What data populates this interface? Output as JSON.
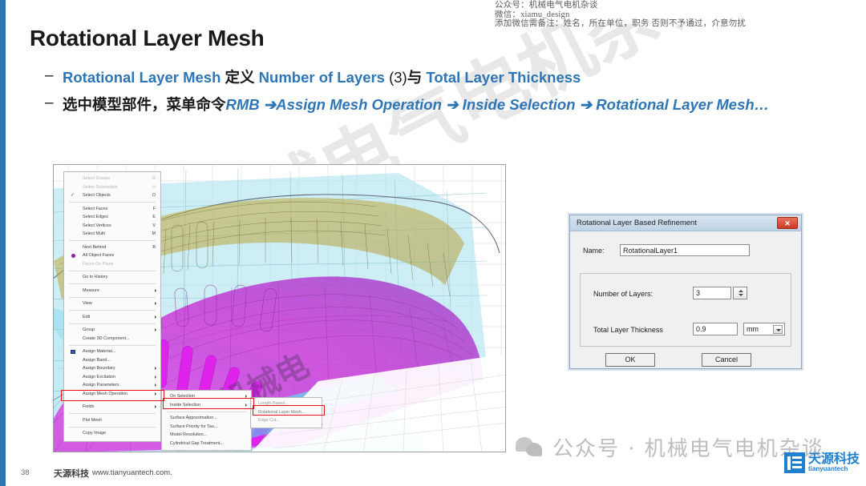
{
  "slide": {
    "title": "Rotational Layer Mesh",
    "page_number": "38",
    "accent_color": "#2e75b6"
  },
  "watermark": {
    "top_lines": [
      "公众号：机械电气电机杂谈",
      "微信：xiamu_design",
      "添加微信需备注：姓名，所在单位，职务 否则不予通过，介意勿扰"
    ],
    "diagonal_text": "机械电气电机杂谈",
    "bottom_text": "公众号 · 机械电气电机杂谈",
    "wechat_icon": "wechat-icon"
  },
  "bullets": [
    {
      "dash": "–",
      "segments": [
        {
          "text": "Rotational Layer Mesh ",
          "style": "blue"
        },
        {
          "text": "定义",
          "style": "black-cjk"
        },
        {
          "text": "  Number of Layers ",
          "style": "blue"
        },
        {
          "text": "(3)",
          "style": "black-plain"
        },
        {
          "text": "与",
          "style": "black-cjk"
        },
        {
          "text": "  Total Layer Thickness",
          "style": "blue"
        }
      ]
    },
    {
      "dash": "–",
      "segments": [
        {
          "text": "选中模型部件，菜单命令",
          "style": "black-cjk"
        },
        {
          "text": "RMB ➔Assign Mesh Operation ➔ Inside Selection ➔ Rotational Layer Mesh…",
          "style": "blue-italic"
        }
      ]
    }
  ],
  "context_menu": {
    "level1": [
      {
        "label": "Select Groups",
        "accel": "G",
        "disabled": true
      },
      {
        "label": "Select Submodels",
        "accel": "U",
        "disabled": true
      },
      {
        "label": "Select Objects",
        "accel": "O",
        "checked": true
      },
      {
        "sep": true
      },
      {
        "label": "Select Faces",
        "accel": "F"
      },
      {
        "label": "Select Edges",
        "accel": "E"
      },
      {
        "label": "Select Vertices",
        "accel": "V"
      },
      {
        "label": "Select Multi",
        "accel": "M"
      },
      {
        "sep": true
      },
      {
        "label": "Next Behind",
        "accel": "B"
      },
      {
        "label": "All Object Faces",
        "icon": "magenta-dot"
      },
      {
        "label": "Faces On Plane",
        "disabled": true
      },
      {
        "sep": true
      },
      {
        "label": "Go to History"
      },
      {
        "sep": true
      },
      {
        "label": "Measure",
        "submenu": true
      },
      {
        "sep": true
      },
      {
        "label": "View",
        "submenu": true
      },
      {
        "sep": true
      },
      {
        "label": "Edit",
        "submenu": true
      },
      {
        "sep": true
      },
      {
        "label": "Group",
        "submenu": true
      },
      {
        "label": "Create 3D Component..."
      },
      {
        "sep": true
      },
      {
        "label": "Assign Material...",
        "icon": "material-icon"
      },
      {
        "label": "Assign Band..."
      },
      {
        "label": "Assign Boundary",
        "submenu": true
      },
      {
        "label": "Assign Excitation",
        "submenu": true
      },
      {
        "label": "Assign Parameters",
        "submenu": true
      },
      {
        "label": "Assign Mesh Operation",
        "submenu": true,
        "highlighted": true
      },
      {
        "sep": true
      },
      {
        "label": "Fields",
        "submenu": true
      },
      {
        "sep": true
      },
      {
        "label": "Plot Mesh"
      },
      {
        "sep": true
      },
      {
        "label": "Copy Image"
      }
    ],
    "level2": [
      {
        "label": "On Selection",
        "submenu": true
      },
      {
        "label": "Inside Selection",
        "submenu": true,
        "highlighted": true
      },
      {
        "sep": true
      },
      {
        "label": "Surface Approximation..."
      },
      {
        "label": "Surface Priority for Tau..."
      },
      {
        "label": "Model Resolution..."
      },
      {
        "label": "Cylindrical Gap Treatment..."
      }
    ],
    "level3": [
      {
        "label": "Length Based..."
      },
      {
        "label": "Rotational Layer Mesh...",
        "highlighted": true
      },
      {
        "label": "Edge Cut..."
      }
    ],
    "highlight_color": "#e8110f"
  },
  "dialog": {
    "title": "Rotational Layer Based Refinement",
    "close_label": "✕",
    "name_label": "Name:",
    "name_value": "RotationalLayer1",
    "layers_label": "Number of Layers:",
    "layers_value": "3",
    "thickness_label": "Total Layer Thickness",
    "thickness_value": "0.9",
    "unit_value": "mm",
    "ok_label": "OK",
    "cancel_label": "Cancel"
  },
  "footer": {
    "page": "38",
    "brand_cn": "天源科技",
    "url": "www.tianyuantech.com.",
    "logo_cn": "天源科技",
    "logo_en": "tianyuantech"
  }
}
